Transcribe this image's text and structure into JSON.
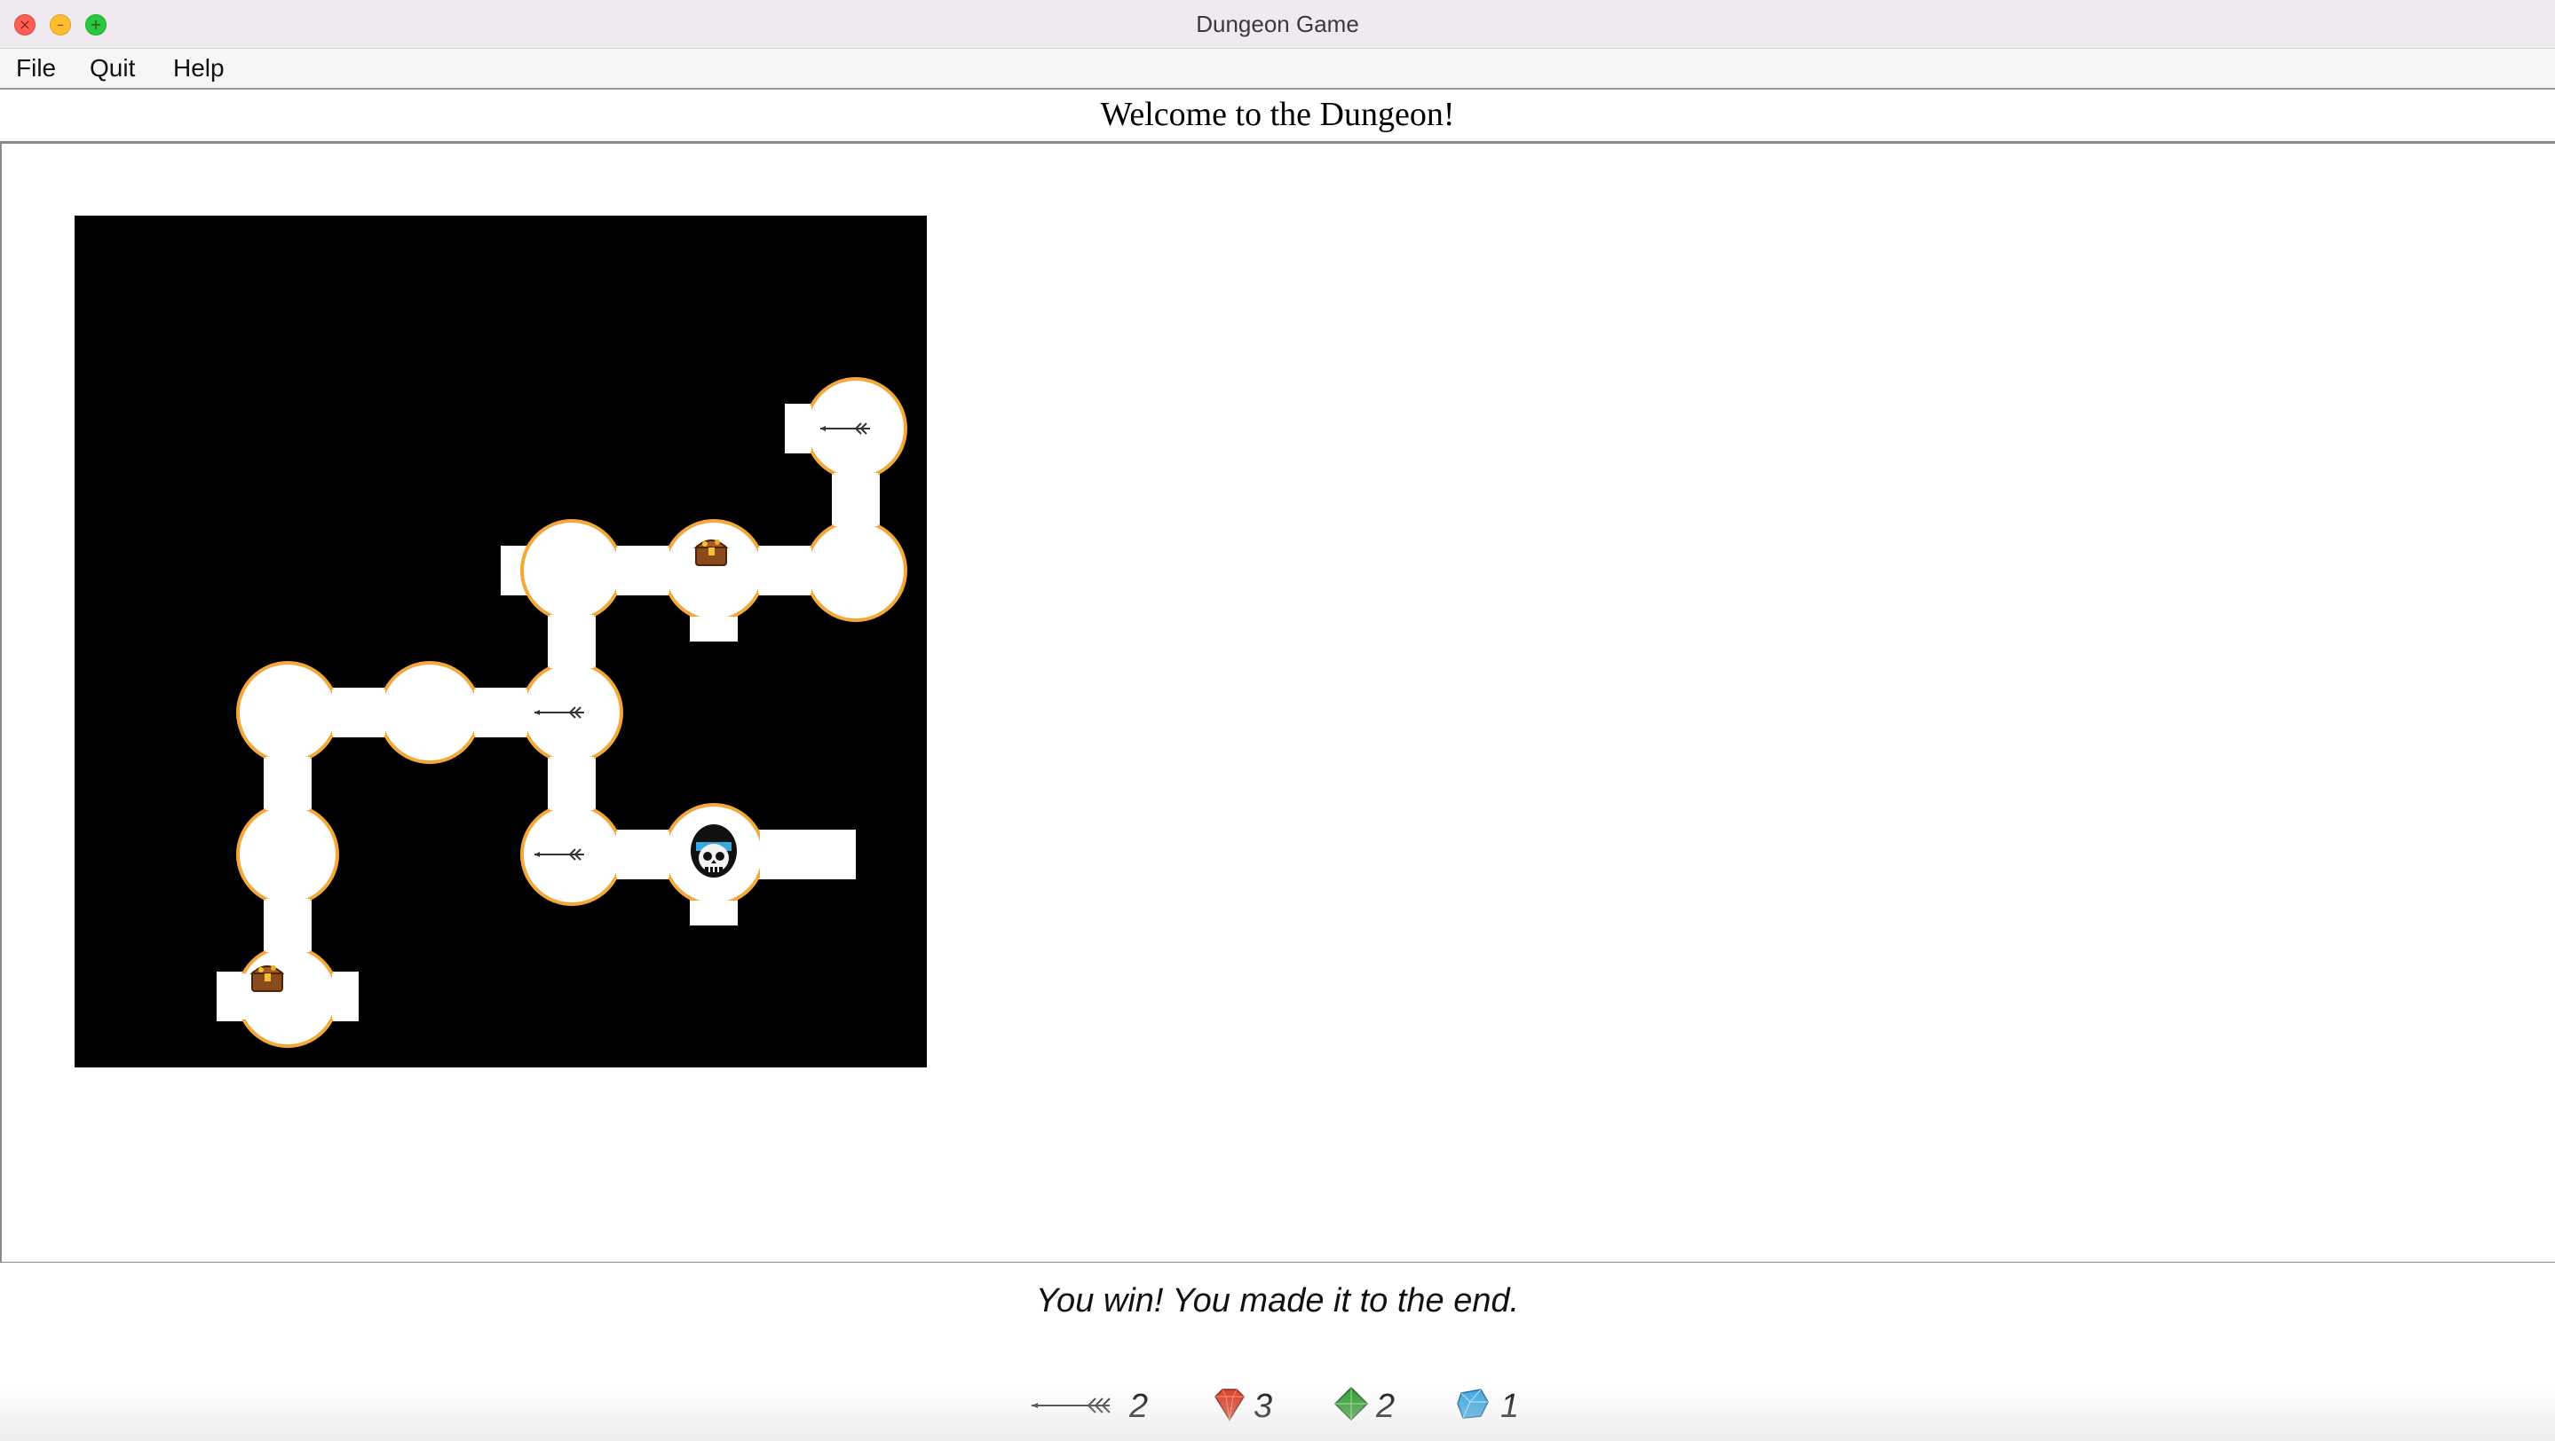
{
  "window": {
    "title": "Dungeon Game"
  },
  "menu": {
    "items": [
      {
        "label": "File"
      },
      {
        "label": "Quit"
      },
      {
        "label": "Help"
      }
    ]
  },
  "header": {
    "welcome": "Welcome to the Dungeon!"
  },
  "map": {
    "background_color": "#000000",
    "room_color": "#ffffff",
    "room_border_color": "#f5a83a",
    "visited_rooms": [
      {
        "row": 1,
        "col": 5,
        "contents": [
          "arrow"
        ]
      },
      {
        "row": 2,
        "col": 3,
        "contents": []
      },
      {
        "row": 2,
        "col": 4,
        "contents": [
          "treasure-chest"
        ]
      },
      {
        "row": 2,
        "col": 5,
        "contents": []
      },
      {
        "row": 3,
        "col": 1,
        "contents": []
      },
      {
        "row": 3,
        "col": 2,
        "contents": []
      },
      {
        "row": 3,
        "col": 3,
        "contents": [
          "arrow"
        ]
      },
      {
        "row": 4,
        "col": 1,
        "contents": []
      },
      {
        "row": 4,
        "col": 3,
        "contents": [
          "arrow"
        ]
      },
      {
        "row": 4,
        "col": 4,
        "contents": [
          "player-skull"
        ]
      },
      {
        "row": 5,
        "col": 1,
        "contents": [
          "treasure-chest"
        ]
      }
    ]
  },
  "status": {
    "message": "You win! You made it to the end."
  },
  "inventory": {
    "arrows": {
      "icon": "arrow-icon",
      "count": "2"
    },
    "rubies": {
      "icon": "ruby-icon",
      "color": "#d83a22",
      "count": "3"
    },
    "emeralds": {
      "icon": "emerald-icon",
      "color": "#2f9a33",
      "count": "2"
    },
    "sapphires": {
      "icon": "sapphire-icon",
      "color": "#3aa8e0",
      "count": "1"
    }
  }
}
